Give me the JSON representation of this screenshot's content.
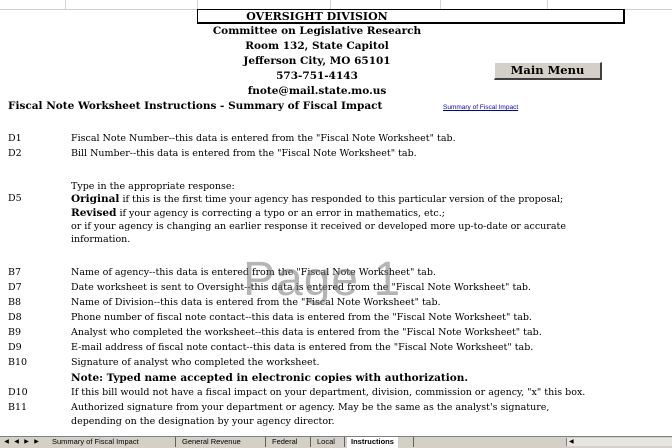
{
  "header": {
    "division": "OVERSIGHT DIVISION",
    "committee": "Committee on Legislative Research",
    "room": "Room 132, State Capitol",
    "city": "Jefferson City, MO  65101",
    "phone": "573-751-4143",
    "email": "fnote@mail.state.mo.us"
  },
  "main_menu_label": "Main Menu",
  "section_title": "Fiscal Note Worksheet Instructions - Summary of  Fiscal Impact",
  "summary_link": "Summary of Fiscal Impact",
  "rows": [
    {
      "code": "D1",
      "text": "Fiscal Note Number--this data is entered from the \"Fiscal Note Worksheet\" tab."
    },
    {
      "code": "D2",
      "text": "Bill Number--this data is entered from the \"Fiscal Note Worksheet\" tab."
    },
    {
      "code": "",
      "text": "Type in the appropriate response:"
    },
    {
      "code": "D5",
      "bold": "Original",
      "text": " if this is the first time your agency has responded to this particular version of the proposal;"
    },
    {
      "code": "",
      "bold": "Revised",
      "text": " if your agency is correcting a typo or an error in mathematics, etc.;"
    },
    {
      "code": "",
      "text": "or if your agency is changing an earlier response it received or developed more up-to-date or accurate"
    },
    {
      "code": "",
      "text": "information."
    },
    {
      "code": "B7",
      "text": "Name of agency--this data is entered from the \"Fiscal Note Worksheet\" tab."
    },
    {
      "code": "D7",
      "text": "Date worksheet is sent to Oversight--this data is entered from the \"Fiscal Note Worksheet\" tab."
    },
    {
      "code": "B8",
      "text": "Name of Division--this data is entered from the \"Fiscal Note Worksheet\" tab."
    },
    {
      "code": "D8",
      "text": "Phone number of fiscal note contact--this data is entered from the \"Fiscal Note Worksheet\" tab."
    },
    {
      "code": "B9",
      "text": "Analyst who completed the worksheet--this data is entered from the \"Fiscal Note Worksheet\" tab."
    },
    {
      "code": "D9",
      "text": "E-mail address of fiscal note contact--this data is entered from the \"Fiscal Note Worksheet\" tab."
    },
    {
      "code": "B10",
      "text": "Signature of analyst who completed the worksheet."
    },
    {
      "code": "",
      "bold": "Note: Typed name accepted in electronic copies with authorization.",
      "text": ""
    },
    {
      "code": "D10",
      "text": "If this bill would not have a fiscal impact on your department, division, commission or agency, \"x\" this box."
    },
    {
      "code": "B11",
      "text": "Authorized signature from your department or agency. May be the same as the analyst's signature,"
    },
    {
      "code": "",
      "text": "depending on the designation by your agency director."
    }
  ],
  "watermark": "Page 1",
  "tabs": [
    "Summary of Fiscal Impact",
    "General Revenue",
    "Federal",
    "Local",
    "Instructions"
  ],
  "active_tab": "Instructions"
}
